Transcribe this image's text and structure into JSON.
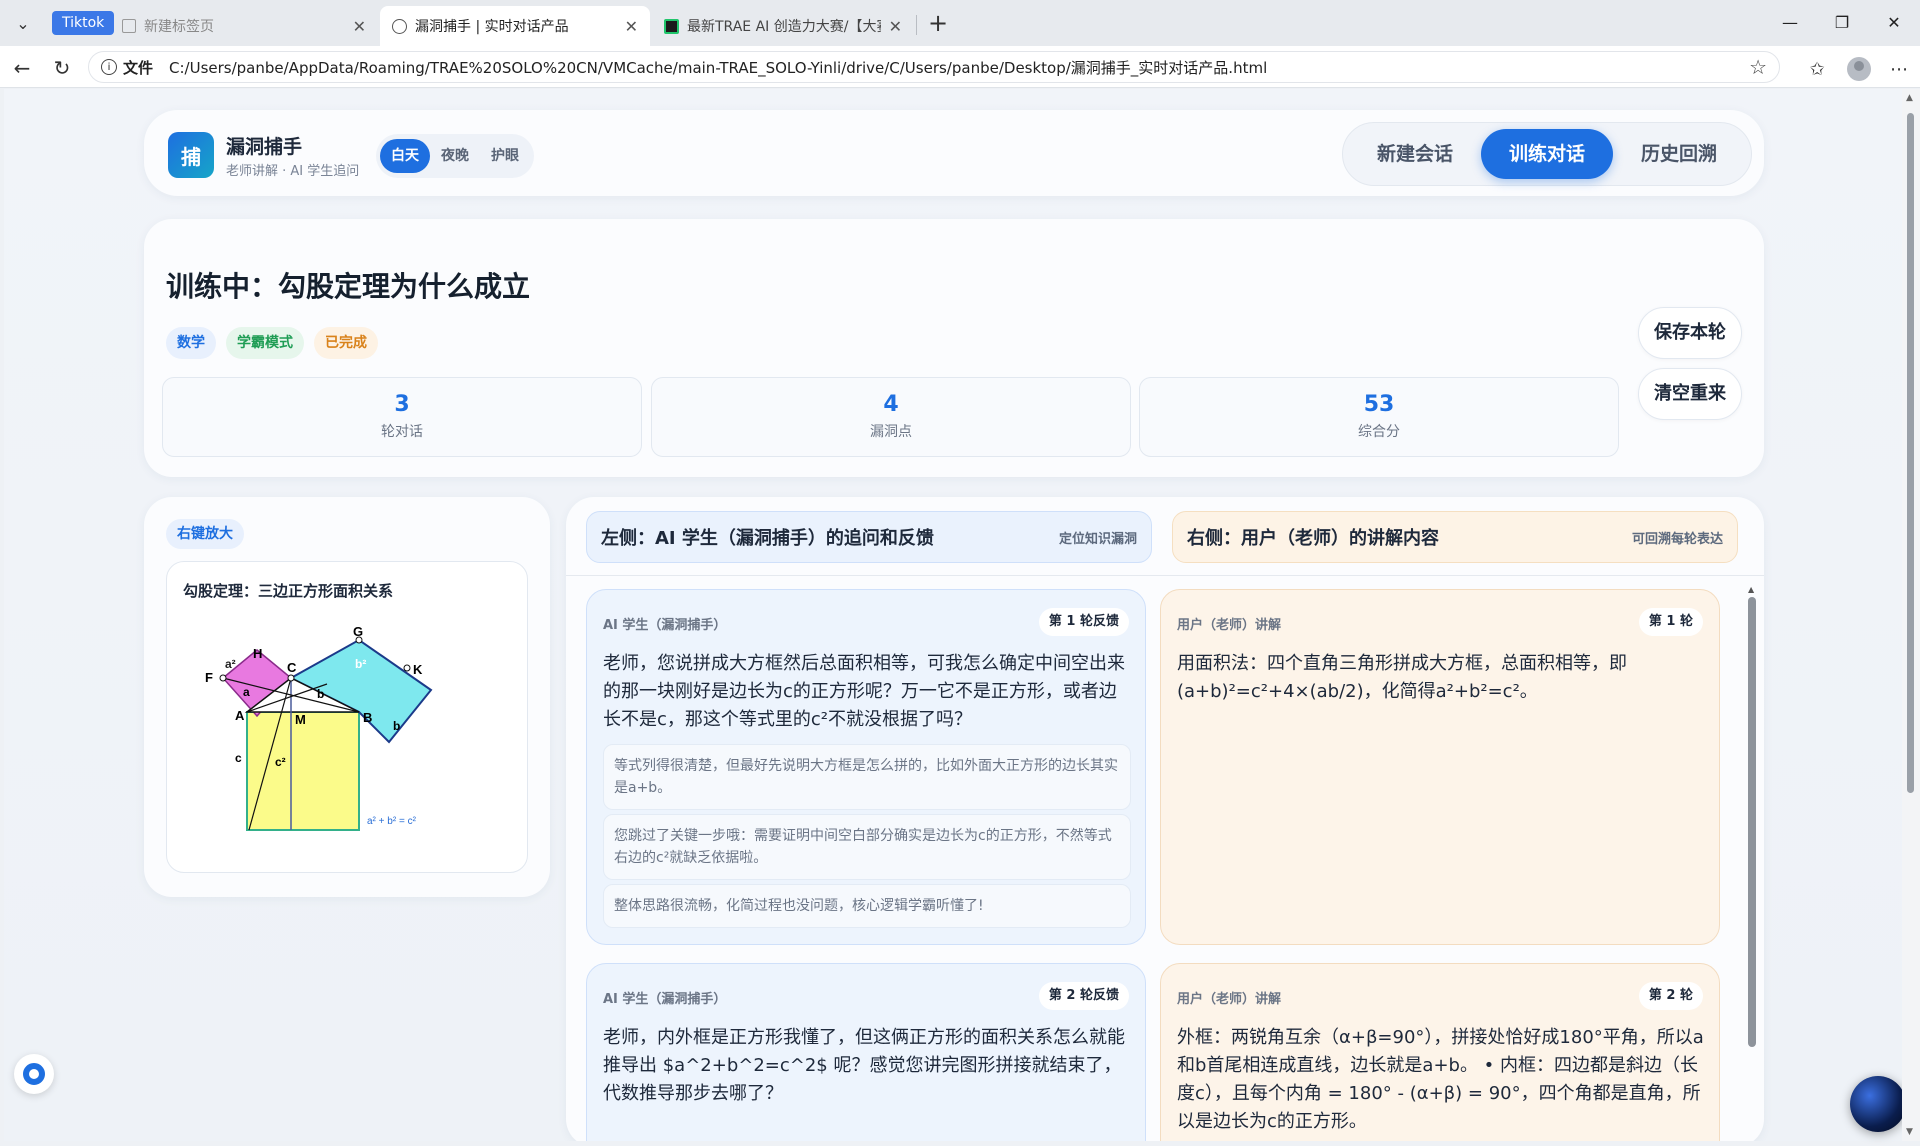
{
  "browser": {
    "tab_menu": "⌄",
    "pinned_tab": "Tiktok",
    "tabs": [
      {
        "title": "新建标签页",
        "close": "✕"
      },
      {
        "title": "漏洞捕手 | 实时对话产品",
        "close": "✕"
      },
      {
        "title": "最新TRAE AI 创造力大赛/【大赛初",
        "close": "✕"
      }
    ],
    "new_tab": "+",
    "window": {
      "minimize": "—",
      "restore": "❐",
      "close": "✕"
    },
    "url_scheme_label": "文件",
    "url": "C:/Users/panbe/AppData/Roaming/TRAE%20SOLO%20CN/VMCache/main-TRAE_SOLO-Yinli/drive/C/Users/panbe/Desktop/漏洞捕手_实时对话产品.html"
  },
  "header": {
    "logo_char": "捕",
    "brand_name": "漏洞捕手",
    "brand_sub": "老师讲解 · AI 学生追问",
    "themes": [
      "白天",
      "夜晚",
      "护眼"
    ],
    "active_theme": "白天",
    "nav": [
      "新建会话",
      "训练对话",
      "历史回溯"
    ],
    "active_nav": "训练对话"
  },
  "training": {
    "title": "训练中：勾股定理为什么成立",
    "tags": {
      "subject": "数学",
      "mode": "学霸模式",
      "status": "已完成"
    },
    "stats": [
      {
        "value": "3",
        "label": "轮对话"
      },
      {
        "value": "4",
        "label": "漏洞点"
      },
      {
        "value": "53",
        "label": "综合分"
      }
    ],
    "save_button": "保存本轮",
    "reset_button": "清空重来"
  },
  "diagram": {
    "zoom_tag": "右键放大",
    "title": "勾股定理：三边正方形面积关系",
    "labels": {
      "H": "H",
      "C": "C",
      "G": "G",
      "F": "F",
      "A": "A",
      "M": "M",
      "B": "B",
      "K": "K",
      "a_sq": "a²",
      "b_sq": "b²",
      "c_sq": "c²",
      "a": "a",
      "b": "b",
      "c": "c",
      "formula": "a² + b² = c²"
    }
  },
  "conversation": {
    "left_header": {
      "title": "左侧：AI 学生（漏洞捕手）的追问和反馈",
      "hint": "定位知识漏洞"
    },
    "right_header": {
      "title": "右侧：用户（老师）的讲解内容",
      "hint": "可回溯每轮表达"
    },
    "rounds": [
      {
        "ai_role": "AI 学生（漏洞捕手）",
        "ai_badge": "第 1 轮反馈",
        "ai_question": "老师，您说拼成大方框然后总面积相等，可我怎么确定中间空出来的那一块刚好是边长为c的正方形呢？万一它不是正方形，或者边长不是c，那这个等式里的c²不就没根据了吗？",
        "feedback": [
          "等式列得很清楚，但最好先说明大方框是怎么拼的，比如外面大正方形的边长其实是a+b。",
          "您跳过了关键一步哦：需要证明中间空白部分确实是边长为c的正方形，不然等式右边的c²就缺乏依据啦。",
          "整体思路很流畅，化简过程也没问题，核心逻辑学霸听懂了!"
        ],
        "user_role": "用户（老师）讲解",
        "user_badge": "第 1 轮",
        "user_text": "用面积法：四个直角三角形拼成大方框，总面积相等，即(a+b)²=c²+4×(ab/2)，化简得a²+b²=c²。"
      },
      {
        "ai_role": "AI 学生（漏洞捕手）",
        "ai_badge": "第 2 轮反馈",
        "ai_question": "老师，内外框是正方形我懂了，但这俩正方形的面积关系怎么就能推导出 $a^2+b^2=c^2$ 呢？感觉您讲完图形拼接就结束了，代数推导那步去哪了？",
        "user_role": "用户（老师）讲解",
        "user_badge": "第 2 轮",
        "user_text": "外框：两锐角互余（α+β=90°），拼接处恰好成180°平角，所以a和b首尾相连成直线，边长就是a+b。 • 内框：四边都是斜边（长度c），且每个内角 = 180° - (α+β) = 90°，四个角都是直角，所以是边长为c的正方形。"
      }
    ]
  }
}
